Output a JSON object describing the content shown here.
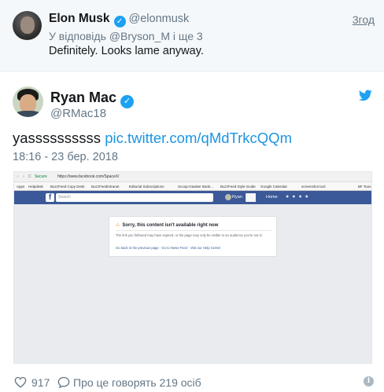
{
  "reply_parent": {
    "name": "Elon Musk",
    "handle": "@elonmusk",
    "time": "3год",
    "reply_to": "У відповідь @Bryson_M і ще 3",
    "text": "Definitely. Looks lame anyway."
  },
  "tweet": {
    "name": "Ryan Mac",
    "handle": "@RMac18",
    "text": "yassssssssss",
    "link": "pic.twitter.com/qMdTrkcQQm",
    "date": "18:16 - 23 бер. 2018"
  },
  "embedded_screenshot": {
    "secure_label": "Secure",
    "url": "https://www.facebook.com/SpaceX/",
    "bookmarks": [
      "Apps",
      "Helpdesk",
      "BuzzFeed Copy Desk",
      "BuzzFeedIntranet",
      "Editorial Subscriptions",
      "Scoop-Gawker Bank...",
      "BuzzFeed Style Guide",
      "Google Calendar",
      "screenshot tool",
      "BF Toos"
    ],
    "search_placeholder": "Search",
    "user_label": "Ryan",
    "home_label": "Home",
    "card_title": "Sorry, this content isn't available right now",
    "card_body": "The link you followed may have expired, or the page may only be visible to an audience you're not in.",
    "card_links": "Go back to the previous page · Go to News Feed · Visit our Help Center"
  },
  "footer": {
    "likes": "917",
    "talking": "Про це говорять 219 осіб",
    "info_symbol": "i"
  },
  "colors": {
    "accent": "#1da1f2",
    "link": "#1b95e0",
    "facebook": "#3b5998",
    "muted": "#657786"
  },
  "icons": [
    "verified-badge-icon",
    "twitter-bird-icon",
    "heart-icon",
    "reply-bubble-icon",
    "info-icon"
  ]
}
